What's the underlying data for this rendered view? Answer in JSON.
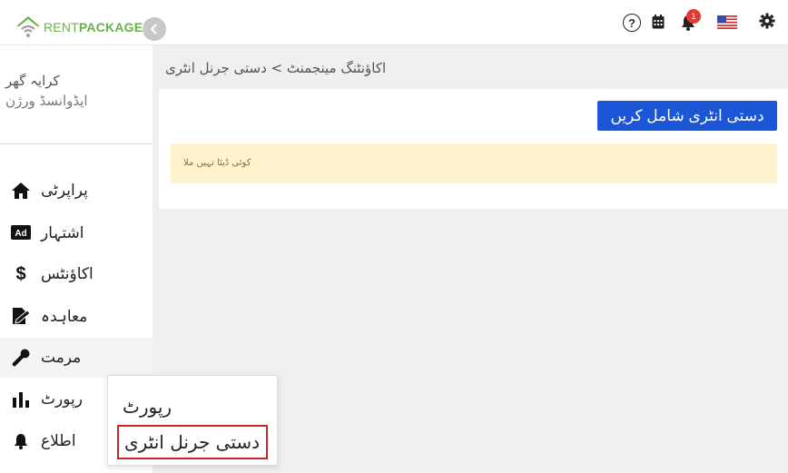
{
  "brand": {
    "rent": "RENT",
    "package": "PACKAGE",
    "logo_icon": "house-wifi-logo",
    "color": "#6ab04c"
  },
  "topbar": {
    "help_icon_glyph": "?",
    "notifications_count": "1",
    "icons": [
      "help-icon",
      "calendar-icon",
      "bell-icon",
      "us-flag-icon",
      "gear-icon"
    ]
  },
  "sidebar": {
    "user_name": "کرایہ گھر",
    "user_plan": "ایڈوانسڈ ورژن",
    "items": [
      {
        "label": "پراپرٹی",
        "icon": "home-icon"
      },
      {
        "label": "اشتہار",
        "icon": "ad-icon"
      },
      {
        "label": "اکاؤنٹس",
        "icon": "dollar-icon"
      },
      {
        "label": "معاہدہ",
        "icon": "contract-icon"
      },
      {
        "label": "مرمت",
        "icon": "wrench-icon"
      },
      {
        "label": "رپورٹ",
        "icon": "bar-chart-icon"
      },
      {
        "label": "اطلاع",
        "icon": "bell-icon"
      }
    ]
  },
  "main": {
    "breadcrumb": "اکاؤنٹنگ مینجمنٹ > دستی جرنل انٹری",
    "add_button": "دستی انٹری شامل کریں",
    "empty_message": "کوئی ڈیٹا نہیں ملا"
  },
  "popup": {
    "items": [
      "رپورٹ",
      "دستی جرنل انٹری"
    ]
  },
  "colors": {
    "primary": "#1a56d6",
    "alert_bg": "#fff3cd",
    "badge": "#e53935",
    "highlight_border": "#c62828"
  }
}
